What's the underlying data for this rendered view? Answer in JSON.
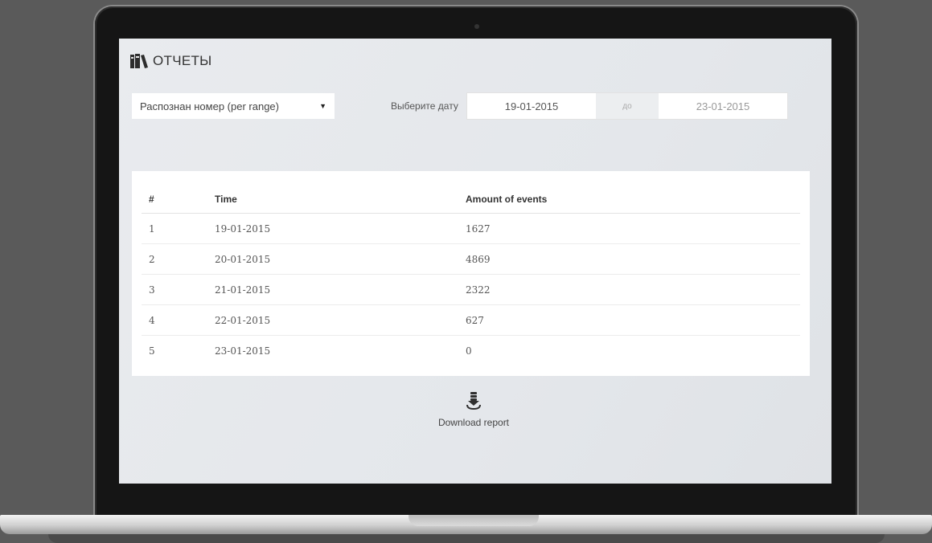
{
  "header": {
    "title": "ОТЧЕТЫ",
    "icon": "books-icon"
  },
  "filters": {
    "report_type": "Распознан номер (per range)",
    "date_label": "Выберите дату",
    "date_from": "19-01-2015",
    "date_separator": "до",
    "date_to": "23-01-2015"
  },
  "table": {
    "columns": [
      "#",
      "Time",
      "Amount of events"
    ],
    "rows": [
      [
        "1",
        "19-01-2015",
        "1627"
      ],
      [
        "2",
        "20-01-2015",
        "4869"
      ],
      [
        "3",
        "21-01-2015",
        "2322"
      ],
      [
        "4",
        "22-01-2015",
        "627"
      ],
      [
        "5",
        "23-01-2015",
        "0"
      ]
    ]
  },
  "download": {
    "label": "Download report",
    "icon": "download-icon"
  }
}
